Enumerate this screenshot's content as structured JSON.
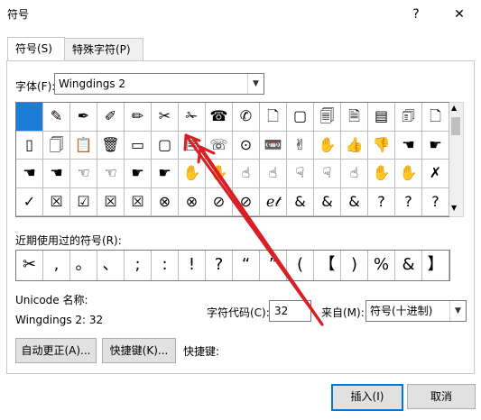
{
  "window": {
    "title": "符号",
    "help_glyph": "?",
    "close_glyph": "✕"
  },
  "tabs": [
    {
      "label": "符号(S)",
      "active": true
    },
    {
      "label": "特殊字符(P)",
      "active": false
    }
  ],
  "font": {
    "label": "字体(F):",
    "value": "Wingdings 2"
  },
  "symbol_grid": {
    "selected_index": 0,
    "rows": [
      [
        "",
        "✎",
        "✒",
        "✐",
        "✏",
        "✂",
        "✁",
        "☎",
        "✆",
        "🗋",
        "▢",
        "🗐",
        "🗎",
        "▤",
        "🗊",
        "🗋"
      ],
      [
        "▯",
        "🗍",
        "📋",
        "🗑",
        "▭",
        "▢",
        "🗏",
        "☏",
        "⊙",
        "📼",
        "✌",
        "✋",
        "👍",
        "👎",
        "☚",
        "☛"
      ],
      [
        "☚",
        "☚",
        "☜",
        "☜",
        "☛",
        "☛",
        "✋",
        "✋",
        "☝",
        "☝",
        "☟",
        "☟",
        "☝",
        "✋",
        "✋",
        "✗"
      ],
      [
        "✓",
        "☒",
        "☑",
        "☒",
        "☒",
        "⊗",
        "⊗",
        "⊘",
        "⊘",
        "ℯ𝓉",
        "&",
        "&",
        "&",
        "?",
        "?",
        "?"
      ]
    ]
  },
  "recent": {
    "label": "近期使用过的符号(R):",
    "symbols": [
      "✂",
      ",",
      "。",
      "、",
      ";",
      ":",
      "!",
      "?",
      "“",
      "”",
      "(",
      "【",
      ")",
      "%",
      "&",
      "】"
    ]
  },
  "unicode_name": {
    "label": "Unicode 名称:",
    "value": "Wingdings 2: 32"
  },
  "char_code": {
    "label": "字符代码(C):",
    "value": "32"
  },
  "from": {
    "label": "来自(M):",
    "value": "符号(十进制)"
  },
  "buttons": {
    "autocorrect": "自动更正(A)...",
    "shortcut_key": "快捷键(K)...",
    "shortcut_label": "快捷键:",
    "insert": "插入(I)",
    "cancel": "取消"
  },
  "annotation_color": "#d81f26",
  "accent_color": "#1c7cd6"
}
